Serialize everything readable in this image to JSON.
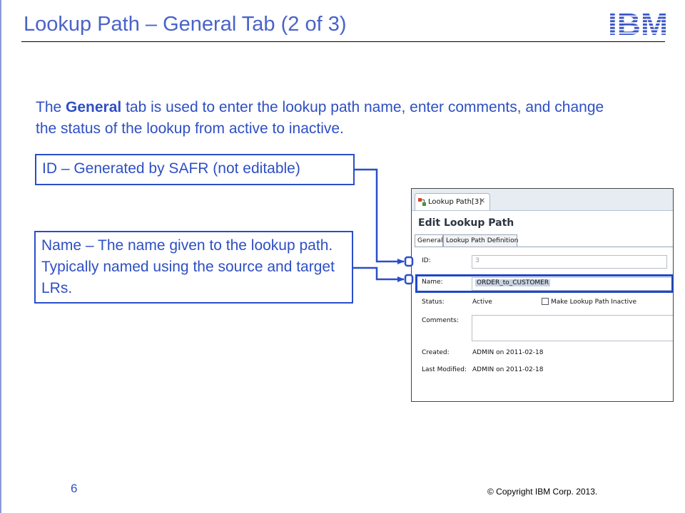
{
  "slide": {
    "title": "Lookup Path – General Tab (2 of 3)",
    "logo_text": "IBM",
    "intro_prefix": "The ",
    "intro_bold": "General",
    "intro_suffix": " tab is used to enter the lookup path name, enter comments, and change the status of the lookup from active to inactive.",
    "page_number": "6",
    "copyright": "© Copyright  IBM Corp. 2013."
  },
  "callouts": {
    "id_text": "ID – Generated by SAFR (not editable)",
    "name_text": "Name – The name given to the lookup path. Typically named using the source and target LRs."
  },
  "screenshot": {
    "tab_label": "Lookup Path[3]",
    "tab_close": "✕",
    "heading": "Edit Lookup Path",
    "subtabs": [
      "General",
      "Lookup Path Definition"
    ],
    "fields": {
      "id_label": "ID:",
      "id_value": "3",
      "name_label": "Name:",
      "name_value": "ORDER_to_CUSTOMER",
      "status_label": "Status:",
      "status_value": "Active",
      "inactive_checkbox_label": "Make Lookup Path Inactive",
      "inactive_checked": false,
      "comments_label": "Comments:",
      "comments_value": "",
      "created_label": "Created:",
      "created_value": "ADMIN on 2011-02-18",
      "modified_label": "Last Modified:",
      "modified_value": "ADMIN on 2011-02-18"
    }
  },
  "colors": {
    "accent_blue": "#2e4fc4",
    "focus_border": "#1e47c9"
  }
}
